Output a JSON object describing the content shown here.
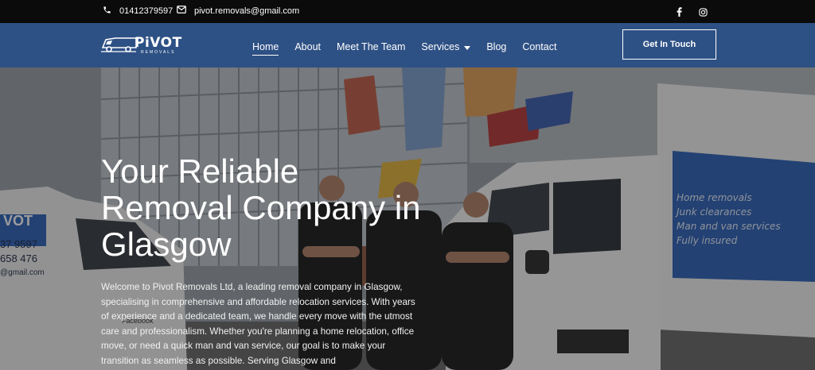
{
  "topbar": {
    "phone": "01412379597",
    "email": "pivot.removals@gmail.com",
    "icons": {
      "phone": "phone-icon",
      "email": "envelope-icon",
      "facebook": "facebook-icon",
      "instagram": "instagram-icon"
    }
  },
  "header": {
    "logo_text": "PiVOT",
    "logo_sub": "REMOVALS",
    "nav": [
      {
        "label": "Home",
        "active": true
      },
      {
        "label": "About"
      },
      {
        "label": "Meet The Team"
      },
      {
        "label": "Services",
        "has_dropdown": true
      },
      {
        "label": "Blog"
      },
      {
        "label": "Contact"
      }
    ],
    "cta_label": "Get In Touch"
  },
  "hero": {
    "title": "Your Reliable Removal Company in Glasgow",
    "paragraph": "Welcome to Pivot Removals Ltd, a leading removal company in Glasgow, specialising in comprehensive and affordable relocation services. With years of experience and a dedicated team, we handle every move with the utmost care and professionalism. Whether you're planning a home relocation, office move, or need a quick man and van service, our goal is to make your transition as seamless as possible. Serving Glasgow and",
    "van_left": {
      "brand": "VOT",
      "phone_line1": "37 9597",
      "phone_line2": "658 476",
      "email_fragment": "@gmail.com",
      "social": "Facebook"
    },
    "van_right": {
      "services": [
        "Home removals",
        "Junk clearances",
        "Man and van services",
        "Fully insured"
      ]
    }
  },
  "colors": {
    "header": "#2e5185",
    "topbar": "#0b0b0b",
    "van_panel": "#2f63b8"
  }
}
